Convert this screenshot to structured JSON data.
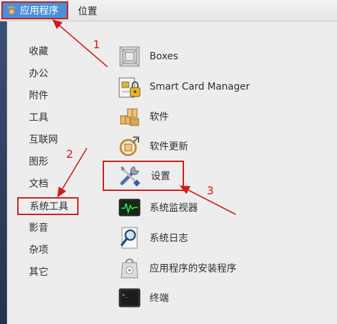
{
  "topbar": {
    "applications_label": "应用程序",
    "places_label": "位置"
  },
  "categories": [
    {
      "label": "收藏"
    },
    {
      "label": "办公"
    },
    {
      "label": "附件"
    },
    {
      "label": "工具"
    },
    {
      "label": "互联网"
    },
    {
      "label": "图形"
    },
    {
      "label": "文档"
    },
    {
      "label": "系统工具"
    },
    {
      "label": "影音"
    },
    {
      "label": "杂项"
    },
    {
      "label": "其它"
    }
  ],
  "selected_category": "系统工具",
  "apps": [
    {
      "label": "Boxes",
      "icon": "boxes-icon"
    },
    {
      "label": "Smart Card Manager",
      "icon": "smart-card-icon"
    },
    {
      "label": "软件",
      "icon": "software-icon"
    },
    {
      "label": "软件更新",
      "icon": "software-update-icon"
    },
    {
      "label": "设置",
      "icon": "settings-icon"
    },
    {
      "label": "系统监视器",
      "icon": "system-monitor-icon"
    },
    {
      "label": "系统日志",
      "icon": "system-log-icon"
    },
    {
      "label": "应用程序的安装程序",
      "icon": "app-installer-icon"
    },
    {
      "label": "终端",
      "icon": "terminal-icon"
    }
  ],
  "annotations": {
    "step1": "1",
    "step2": "2",
    "step3": "3",
    "color": "#d11a1a"
  },
  "colors": {
    "accent": "#4a8fd9",
    "menu_bg": "#ededed"
  }
}
